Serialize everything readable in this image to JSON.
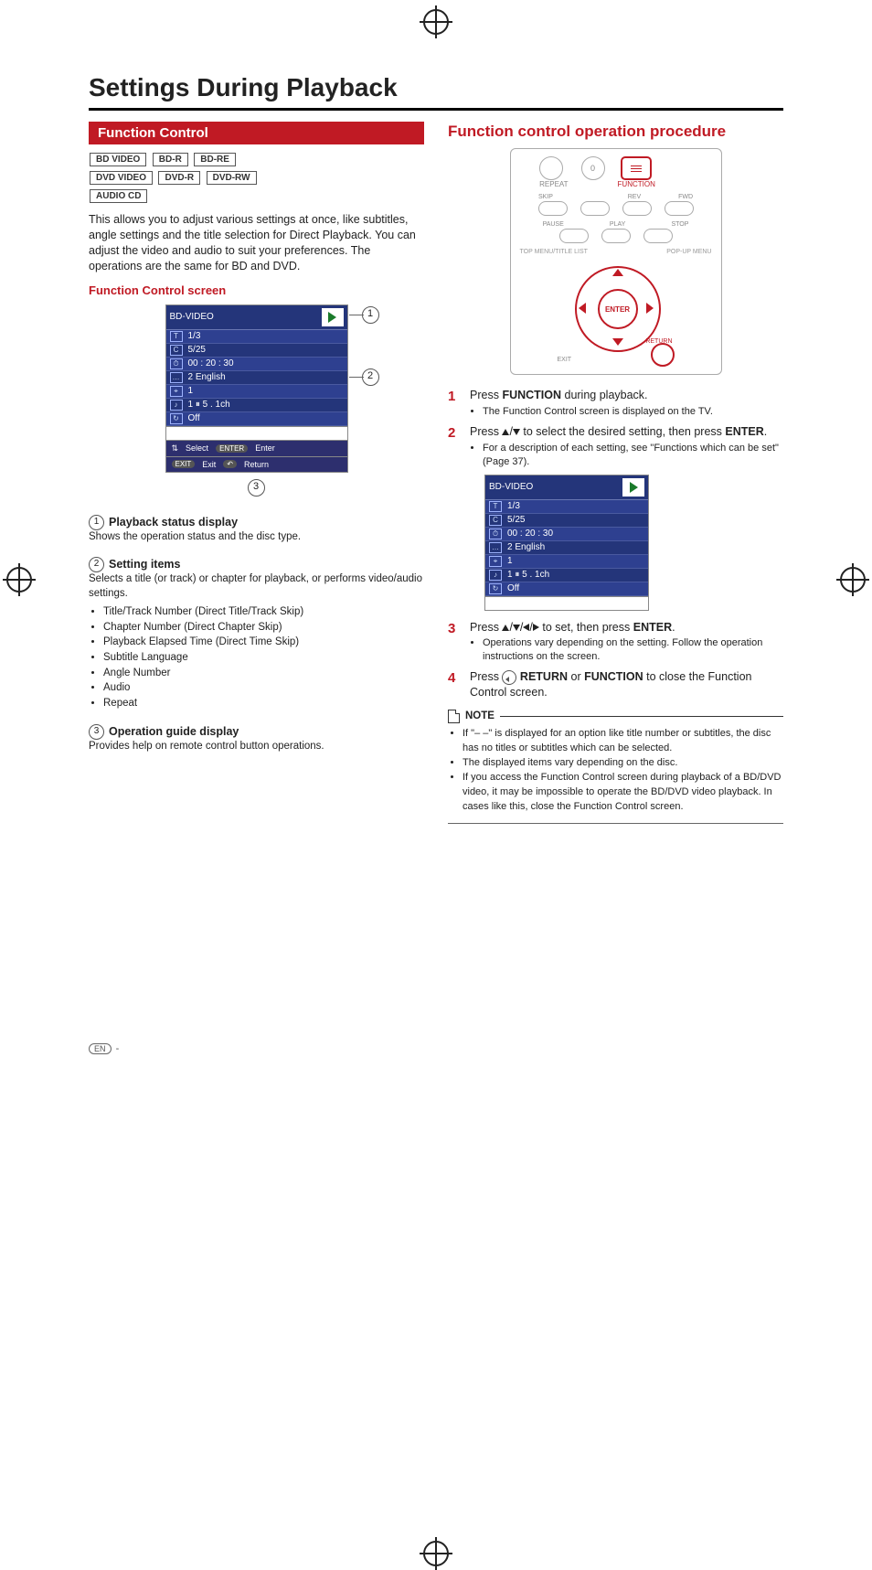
{
  "page_title": "Settings During Playback",
  "left": {
    "heading": "Function Control",
    "media_row1": [
      "BD VIDEO",
      "BD-R",
      "BD-RE"
    ],
    "media_row2": [
      "DVD VIDEO",
      "DVD-R",
      "DVD-RW"
    ],
    "media_row3": [
      "AUDIO CD"
    ],
    "intro": "This allows you to adjust various settings at once, like subtitles, angle settings and the title selection for Direct Playback. You can adjust the video and audio to suit your preferences. The operations are the same for BD and DVD.",
    "screen_heading": "Function Control screen",
    "fc_disc": "BD-VIDEO",
    "fc_rows": [
      "1/3",
      "5/25",
      "00 : 20 : 30",
      "2 English",
      "1",
      "1    ⏸  5 . 1ch",
      "Off"
    ],
    "guide_select": "Select",
    "guide_enter": "Enter",
    "guide_exit": "Exit",
    "guide_return": "Return",
    "callouts": {
      "c1": "1",
      "c2": "2",
      "c3": "3"
    },
    "d1_title": "Playback status display",
    "d1_text": "Shows the operation status and the disc type.",
    "d2_title": "Setting items",
    "d2_text": "Selects a title (or track) or chapter for playback, or performs video/audio settings.",
    "d2_bullets": [
      "Title/Track Number (Direct Title/Track Skip)",
      "Chapter Number (Direct Chapter Skip)",
      "Playback Elapsed Time (Direct Time Skip)",
      "Subtitle Language",
      "Angle Number",
      "Audio",
      "Repeat"
    ],
    "d3_title": "Operation guide display",
    "d3_text": "Provides help on remote control button operations."
  },
  "right": {
    "heading": "Function control operation procedure",
    "remote": {
      "zero": "0",
      "repeat": "REPEAT",
      "function": "FUNCTION",
      "skip_back": "SKIP",
      "rev": "REV",
      "fwd": "FWD",
      "pause": "PAUSE",
      "play": "PLAY",
      "stop": "STOP",
      "top_menu": "TOP MENU/TITLE LIST",
      "popup": "POP-UP MENU",
      "enter": "ENTER",
      "exit": "EXIT",
      "return": "RETURN"
    },
    "step1_a": "Press ",
    "step1_b": "FUNCTION",
    "step1_c": " during playback.",
    "step1_bullet": "The Function Control screen is displayed on the TV.",
    "step2_a": "Press ",
    "step2_b": " to select the desired setting, then press ",
    "step2_c": "ENTER",
    "step2_d": ".",
    "step2_bullet": "For a description of each setting, see \"Functions which can be set\" (Page 37).",
    "step3_a": "Press ",
    "step3_b": " to set, then press ",
    "step3_c": "ENTER",
    "step3_d": ".",
    "step3_bullet": "Operations vary depending on the setting. Follow the operation instructions on the screen.",
    "step4_a": "Press ",
    "step4_b": "RETURN",
    "step4_c": " or ",
    "step4_d": "FUNCTION",
    "step4_e": " to close the Function Control screen.",
    "note_label": "NOTE",
    "notes": [
      "If \"– –\" is displayed for an option like title number or subtitles, the disc has no titles or subtitles which can be selected.",
      "The displayed items vary depending on the disc.",
      "If you access the Function Control screen during playback of a BD/DVD video, it may be impossible to operate the BD/DVD video playback. In cases like this, close the Function Control screen."
    ]
  },
  "footer": {
    "en": "EN",
    "dash": " -"
  }
}
